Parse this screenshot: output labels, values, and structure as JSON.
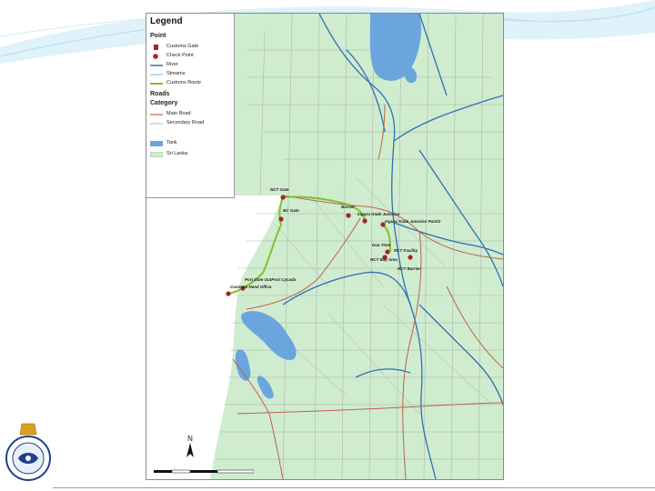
{
  "legend": {
    "title": "Legend",
    "sections": {
      "point": "Point",
      "roads": "Roads",
      "category": "Category"
    },
    "items": {
      "customs_gate": "Customs Gate",
      "check_point": "Check Point",
      "river": "River",
      "streams": "Streams",
      "customs_route": "Customs Route",
      "main_road": "Main Road",
      "secondary_road": "Secondary Road",
      "tank": "Tank",
      "sri_lanka": "Sri Lanka"
    }
  },
  "map_labels": [
    {
      "key": "nct_gate",
      "text": "NCT Gate"
    },
    {
      "key": "bc_gate",
      "text": "BC Gate"
    },
    {
      "key": "barrier",
      "text": "Barrier"
    },
    {
      "key": "ingurukade_junction",
      "text": "Inguru Kade Junction"
    },
    {
      "key": "ingurukade_junction_point2",
      "text": "Inguru Kade Junction Point2"
    },
    {
      "key": "dua_time",
      "text": "Dua Time"
    },
    {
      "key": "rct_facility",
      "text": "RCT Facility"
    },
    {
      "key": "rct_bay_area",
      "text": "RCT Bay Area"
    },
    {
      "key": "rct_barrier",
      "text": "RCT Barrier"
    },
    {
      "key": "port_gate_outpost",
      "text": "Port Gate OutPost Cycada"
    },
    {
      "key": "customs_head_office",
      "text": "Customs Head Office"
    }
  ],
  "north_arrow": "N",
  "colors": {
    "land": "#cfeccf",
    "river": "#2f6fb5",
    "tank": "#6aa6dd",
    "main_road": "#c0604a",
    "secondary_road": "#a0a0a0",
    "customs_route": "#7fc12a",
    "check_point": "#a3232a",
    "sea": "#ffffff"
  }
}
